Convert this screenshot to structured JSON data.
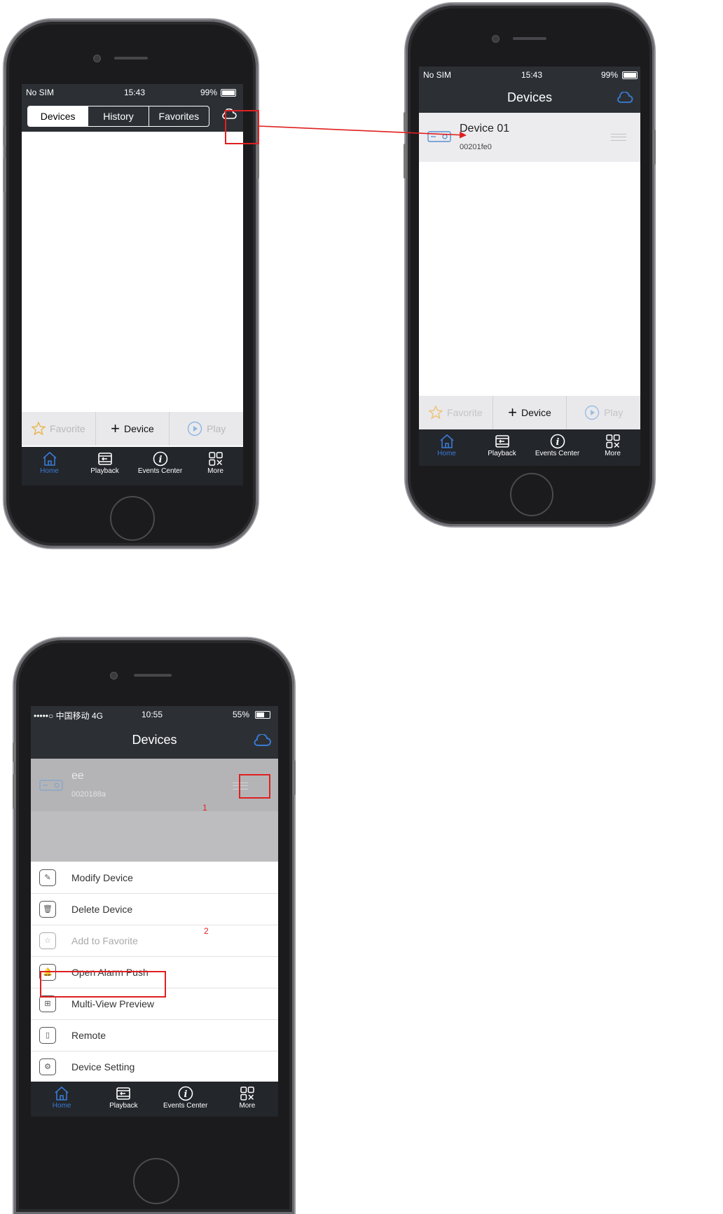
{
  "colors": {
    "accent": "#3a7bd5",
    "annotation": "#e02020",
    "navbar": "#2c3035",
    "tabbar": "#23262b"
  },
  "phone1": {
    "status": {
      "carrier": "No SIM",
      "time": "15:43",
      "battery": "99%"
    },
    "segments": [
      "Devices",
      "History",
      "Favorites"
    ],
    "toolbar": {
      "favorite": "Favorite",
      "device": "Device",
      "play": "Play"
    },
    "tabs": [
      "Home",
      "Playback",
      "Events Center",
      "More"
    ]
  },
  "phone2": {
    "status": {
      "carrier": "No SIM",
      "time": "15:43",
      "battery": "99%"
    },
    "title": "Devices",
    "device": {
      "name": "Device 01",
      "id": "00201fe0"
    },
    "toolbar": {
      "favorite": "Favorite",
      "device": "Device",
      "play": "Play"
    },
    "tabs": [
      "Home",
      "Playback",
      "Events Center",
      "More"
    ]
  },
  "phone3": {
    "status": {
      "carrier": "•••••○ 中国移动  4G",
      "time": "10:55",
      "battery": "55%"
    },
    "title": "Devices",
    "device": {
      "name": "ee",
      "id": "0020188a"
    },
    "menu": [
      {
        "label": "Modify Device",
        "icon": "pencil-icon"
      },
      {
        "label": "Delete Device",
        "icon": "trash-icon"
      },
      {
        "label": "Add to Favorite",
        "icon": "star-icon"
      },
      {
        "label": "Open Alarm Push",
        "icon": "alarm-bell-icon"
      },
      {
        "label": "Multi-View Preview",
        "icon": "multi-view-icon"
      },
      {
        "label": "Remote",
        "icon": "remote-icon"
      },
      {
        "label": "Device Setting",
        "icon": "gear-icon"
      }
    ],
    "tabs": [
      "Home",
      "Playback",
      "Events Center",
      "More"
    ],
    "annotations": [
      "1",
      "2"
    ]
  }
}
